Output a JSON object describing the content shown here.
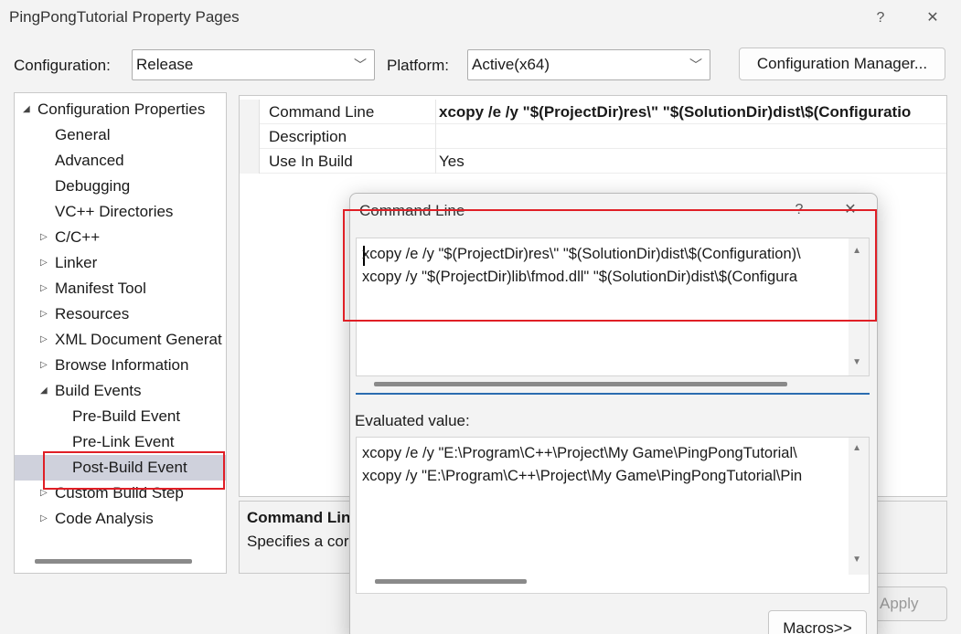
{
  "window": {
    "title": "PingPongTutorial Property Pages",
    "help_glyph": "?",
    "close_glyph": "✕"
  },
  "toolbar": {
    "configuration_label": "Configuration:",
    "configuration_value": "Release",
    "platform_label": "Platform:",
    "platform_value": "Active(x64)",
    "config_manager_label": "Configuration Manager..."
  },
  "tree": {
    "items": [
      {
        "label": "Configuration Properties",
        "arrow": "◢"
      },
      {
        "label": "General"
      },
      {
        "label": "Advanced"
      },
      {
        "label": "Debugging"
      },
      {
        "label": "VC++ Directories"
      },
      {
        "label": "C/C++",
        "arrow": "▷"
      },
      {
        "label": "Linker",
        "arrow": "▷"
      },
      {
        "label": "Manifest Tool",
        "arrow": "▷"
      },
      {
        "label": "Resources",
        "arrow": "▷"
      },
      {
        "label": "XML Document Generat",
        "arrow": "▷"
      },
      {
        "label": "Browse Information",
        "arrow": "▷"
      },
      {
        "label": "Build Events",
        "arrow": "◢"
      },
      {
        "label": "Pre-Build Event"
      },
      {
        "label": "Pre-Link Event"
      },
      {
        "label": "Post-Build Event"
      },
      {
        "label": "Custom Build Step",
        "arrow": "▷"
      },
      {
        "label": "Code Analysis",
        "arrow": "▷"
      }
    ]
  },
  "grid": {
    "rows": [
      {
        "name": "Command Line",
        "value": "xcopy /e /y \"$(ProjectDir)res\\\" \"$(SolutionDir)dist\\$(Configuratio"
      },
      {
        "name": "Description",
        "value": ""
      },
      {
        "name": "Use In Build",
        "value": "Yes"
      }
    ]
  },
  "description": {
    "title": "Command Lin",
    "text": "Specifies a cor"
  },
  "footer": {
    "apply_label": "Apply"
  },
  "dialog": {
    "title": "Command Line",
    "help_glyph": "?",
    "close_glyph": "✕",
    "command_lines": [
      "xcopy /e /y \"$(ProjectDir)res\\\" \"$(SolutionDir)dist\\$(Configuration)\\",
      "xcopy /y \"$(ProjectDir)lib\\fmod.dll\" \"$(SolutionDir)dist\\$(Configura"
    ],
    "evaluated_label": "Evaluated value:",
    "evaluated_lines": [
      "xcopy /e /y \"E:\\Program\\C++\\Project\\My Game\\PingPongTutorial\\",
      "xcopy /y \"E:\\Program\\C++\\Project\\My Game\\PingPongTutorial\\Pin"
    ],
    "macros_label": "Macros>>"
  },
  "colors": {
    "highlight_box": "#e01f26",
    "selected_row": "#cfd1dc",
    "accent_underline": "#2b6cb0"
  }
}
